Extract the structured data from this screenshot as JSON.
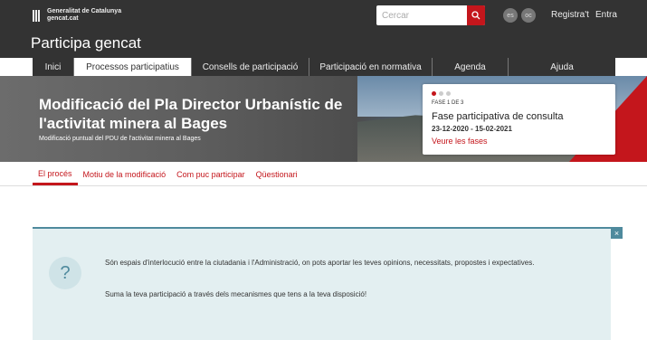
{
  "brand": {
    "logo_line1": "Generalitat de Catalunya",
    "logo_line2": "gencat.cat",
    "site_title": "Participa gencat"
  },
  "header": {
    "search_placeholder": "Cercar",
    "lang_es": "es",
    "lang_oc": "oc",
    "register": "Registra't",
    "login": "Entra"
  },
  "nav": {
    "items": [
      {
        "label": "Inici"
      },
      {
        "label": "Processos participatius"
      },
      {
        "label": "Consells de participació"
      },
      {
        "label": "Participació en normativa"
      },
      {
        "label": "Agenda"
      },
      {
        "label": "Ajuda"
      }
    ]
  },
  "hero": {
    "title": "Modificació del Pla Director Urbanístic de l'activitat minera al Bages",
    "subtitle": "Modificació puntual del PDU de l'activitat minera al Bages"
  },
  "phase": {
    "label": "FASE 1 DE 3",
    "name": "Fase participativa de consulta",
    "dates": "23-12-2020 - 15-02-2021",
    "link": "Veure les fases"
  },
  "tabs": {
    "items": [
      {
        "label": "El procés"
      },
      {
        "label": "Motiu de la modificació"
      },
      {
        "label": "Com puc participar"
      },
      {
        "label": "Qüestionari"
      }
    ]
  },
  "info": {
    "icon": "?",
    "text1": "Són espais d'interlocució entre la ciutadania i l'Administració, on pots aportar les teves opinions, necessitats, propostes i expectatives.",
    "text2": "Suma la teva participació a través dels mecanismes que tens a la teva disposició!",
    "close": "×"
  },
  "colors": {
    "accent": "#c4161c",
    "dark": "#333333",
    "info_bg": "#e3eff1",
    "info_border": "#4f8a9d"
  }
}
